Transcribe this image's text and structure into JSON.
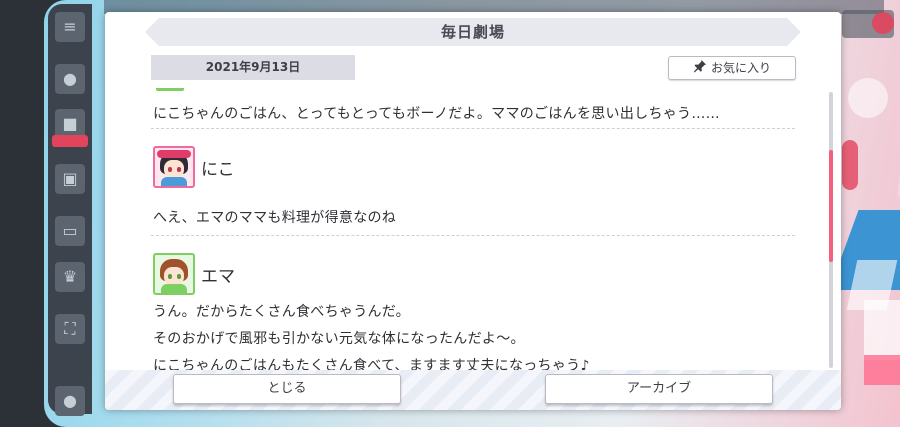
{
  "modal": {
    "title": "毎日劇場",
    "date": "2021年9月13日",
    "favorite_label": "お気に入り",
    "close_label": "とじる",
    "archive_label": "アーカイブ"
  },
  "messages": [
    {
      "speaker": "",
      "lines": [
        "にこちゃんのごはん、とってもとってもボーノだよ。ママのごはんを思い出しちゃう……"
      ]
    },
    {
      "speaker": "にこ",
      "lines": [
        "へえ、エマのママも料理が得意なのね"
      ]
    },
    {
      "speaker": "エマ",
      "lines": [
        "うん。だからたくさん食べちゃうんだ。",
        "そのおかげで風邪も引かない元気な体になったんだよ～。",
        "にこちゃんのごはんもたくさん食べて、ますます丈夫になっちゃう♪"
      ]
    }
  ],
  "icons": {
    "favorite": "pin-icon",
    "menu": "hamburger-menu-icon"
  },
  "colors": {
    "accent": "#f2607c",
    "niko_frame": "#f06aa0",
    "emma_frame": "#7dcf63"
  }
}
